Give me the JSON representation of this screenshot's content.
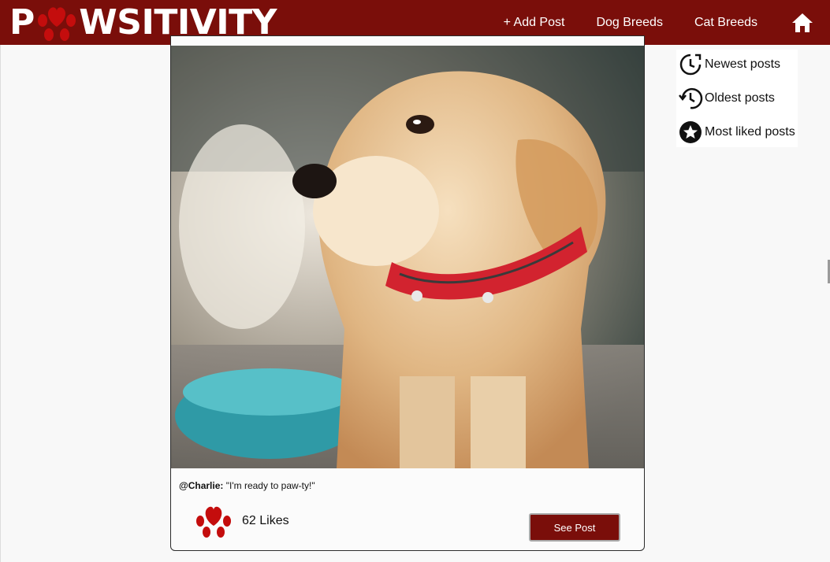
{
  "navbar": {
    "logo_first": "P",
    "logo_rest": "WSITIVITY",
    "add_post": "+ Add Post",
    "dog_breeds": "Dog Breeds",
    "cat_breeds": "Cat Breeds",
    "home_icon": "home-icon"
  },
  "post": {
    "username": "@Charlie:",
    "caption": "\"I'm ready to paw-ty!\"",
    "likes": "62 Likes",
    "see_post": "See Post",
    "image": "golden retriever puppy with red collar"
  },
  "sort": {
    "newest": "Newest posts",
    "oldest": "Oldest posts",
    "most_liked": "Most liked posts"
  },
  "colors": {
    "brand": "#7a0e0a",
    "paw": "#c40d0d"
  }
}
